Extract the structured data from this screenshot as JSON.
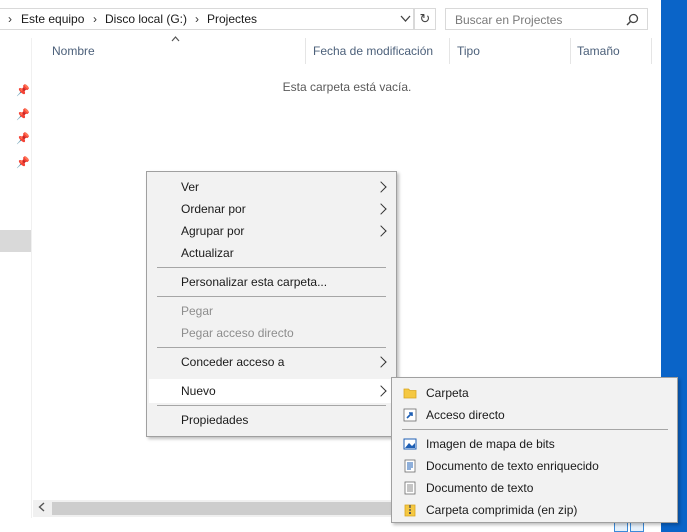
{
  "breadcrumb": {
    "items": [
      "Este equipo",
      "Disco local (G:)",
      "Projectes"
    ]
  },
  "search": {
    "placeholder": "Buscar en Projectes"
  },
  "columns": [
    "Nombre",
    "Fecha de modificación",
    "Tipo",
    "Tamaño"
  ],
  "empty_message": "Esta carpeta está vacía.",
  "context_menu": {
    "items": [
      {
        "label": "Ver",
        "submenu": true,
        "enabled": true
      },
      {
        "label": "Ordenar por",
        "submenu": true,
        "enabled": true
      },
      {
        "label": "Agrupar por",
        "submenu": true,
        "enabled": true
      },
      {
        "label": "Actualizar",
        "submenu": false,
        "enabled": true
      },
      {
        "label": "Personalizar esta carpeta...",
        "submenu": false,
        "enabled": true
      },
      {
        "label": "Pegar",
        "submenu": false,
        "enabled": false
      },
      {
        "label": "Pegar acceso directo",
        "submenu": false,
        "enabled": false
      },
      {
        "label": "Conceder acceso a",
        "submenu": true,
        "enabled": true
      },
      {
        "label": "Nuevo",
        "submenu": true,
        "enabled": true,
        "highlighted": true
      },
      {
        "label": "Propiedades",
        "submenu": false,
        "enabled": true
      }
    ]
  },
  "new_submenu": {
    "items": [
      {
        "label": "Carpeta",
        "icon": "folder-icon"
      },
      {
        "label": "Acceso directo",
        "icon": "shortcut-icon"
      },
      {
        "label": "Imagen de mapa de bits",
        "icon": "bitmap-icon"
      },
      {
        "label": "Documento de texto enriquecido",
        "icon": "rich-text-document-icon"
      },
      {
        "label": "Documento de texto",
        "icon": "text-document-icon"
      },
      {
        "label": "Carpeta comprimida (en zip)",
        "icon": "zip-folder-icon"
      }
    ]
  },
  "colors": {
    "desktop": "#0a64c8",
    "menu_bg": "#f2f2f2",
    "menu_highlight": "#ffffff",
    "column_header": "#4c607a"
  }
}
